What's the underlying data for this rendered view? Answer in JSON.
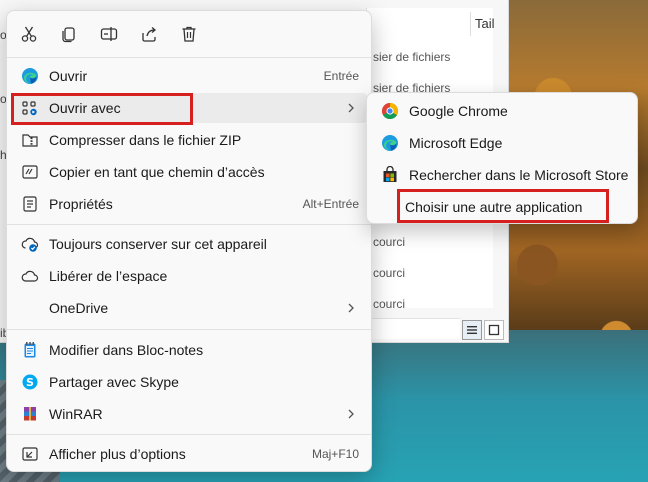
{
  "background": {
    "column_header": "Tail",
    "rows": [
      "sier de fichiers",
      "sier de fichiers",
      "courci",
      "courci",
      "courci"
    ],
    "left_edge_letters": [
      "o",
      "o",
      "h",
      "ib"
    ]
  },
  "quickbar": {
    "icons": [
      "cut-icon",
      "copy-icon",
      "rename-icon",
      "share-icon",
      "delete-icon"
    ]
  },
  "menu": {
    "items": [
      {
        "label": "Ouvrir",
        "shortcut": "Entrée",
        "icon": "edge-icon"
      },
      {
        "label": "Ouvrir avec",
        "shortcut": "",
        "icon": "open-with-icon",
        "has_submenu": true
      },
      {
        "label": "Compresser dans le fichier ZIP",
        "shortcut": "",
        "icon": "zip-icon"
      },
      {
        "label": "Copier en tant que chemin d’accès",
        "shortcut": "",
        "icon": "copy-path-icon"
      },
      {
        "label": "Propriétés",
        "shortcut": "Alt+Entrée",
        "icon": "properties-icon"
      },
      {
        "label": "Toujours conserver sur cet appareil",
        "shortcut": "",
        "icon": "keep-device-icon"
      },
      {
        "label": "Libérer de l’espace",
        "shortcut": "",
        "icon": "cloud-icon"
      },
      {
        "label": "OneDrive",
        "shortcut": "",
        "icon": "",
        "has_submenu": true
      },
      {
        "label": "Modifier dans Bloc-notes",
        "shortcut": "",
        "icon": "notepad-icon"
      },
      {
        "label": "Partager avec Skype",
        "shortcut": "",
        "icon": "skype-icon"
      },
      {
        "label": "WinRAR",
        "shortcut": "",
        "icon": "winrar-icon",
        "has_submenu": true
      },
      {
        "label": "Afficher plus d’options",
        "shortcut": "Maj+F10",
        "icon": "more-options-icon"
      }
    ]
  },
  "submenu": {
    "items": [
      {
        "label": "Google Chrome",
        "icon": "chrome-icon"
      },
      {
        "label": "Microsoft Edge",
        "icon": "edge-icon"
      },
      {
        "label": "Rechercher dans le Microsoft Store",
        "icon": "store-icon"
      },
      {
        "label": "Choisir une autre application",
        "icon": ""
      }
    ]
  },
  "colors": {
    "highlight_border": "#d62020",
    "accent_blue": "#0067c0",
    "menu_bg": "#f9f9f9"
  }
}
